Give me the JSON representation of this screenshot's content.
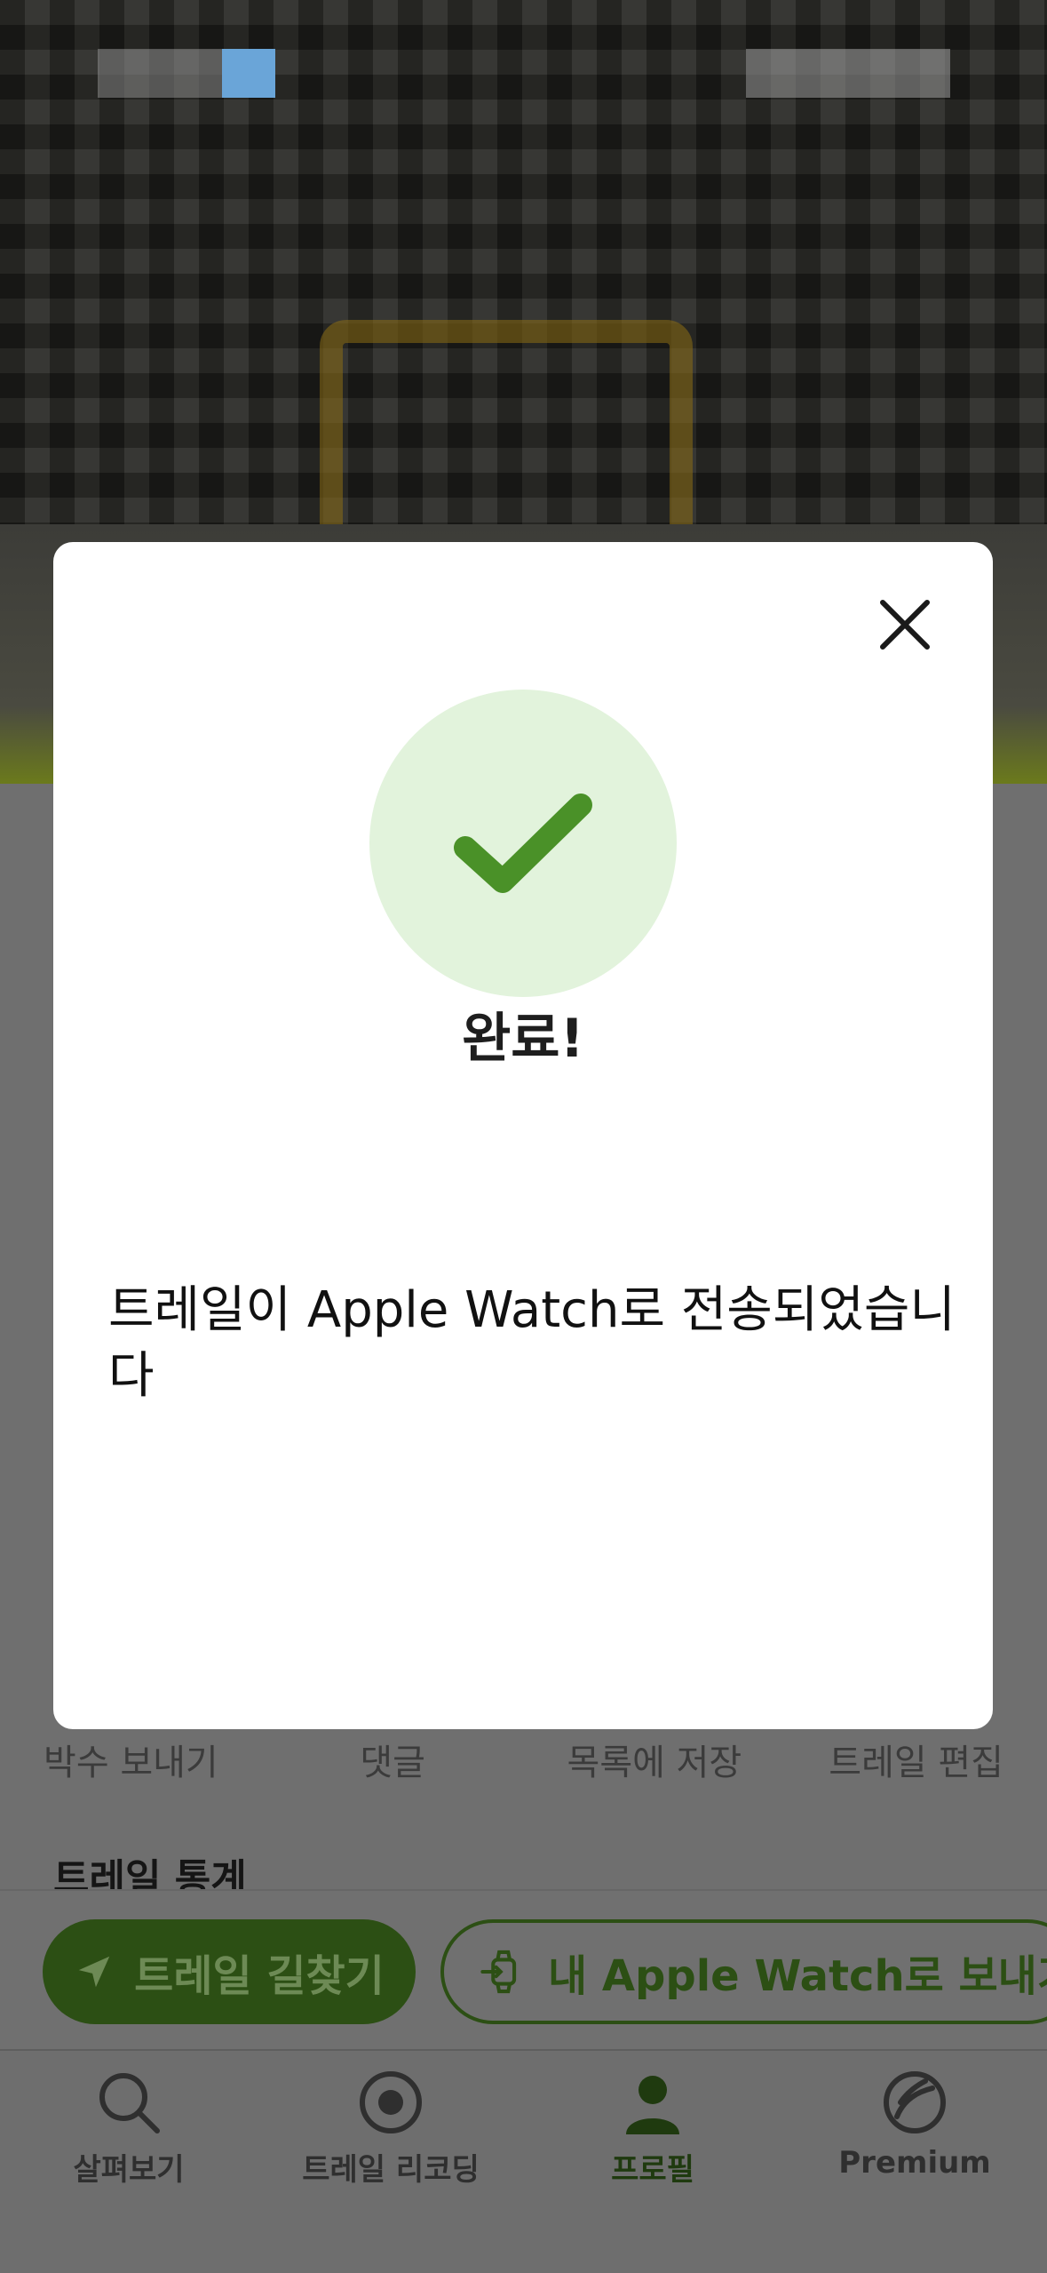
{
  "modal": {
    "title": "완료!",
    "message": "트레일이 Apple Watch로 전송되었습니다"
  },
  "actions": [
    "박수 보내기",
    "댓글",
    "목록에 저장",
    "트레일 편집"
  ],
  "section": {
    "stats_title": "트레일 통계"
  },
  "buttons": {
    "navigate": "트레일 길찾기",
    "send_watch": "내 Apple Watch로 보내기"
  },
  "tabs": [
    {
      "label": "살펴보기",
      "icon": "search-icon"
    },
    {
      "label": "트레일 리코딩",
      "icon": "record-icon"
    },
    {
      "label": "프로필",
      "icon": "profile-icon"
    },
    {
      "label": "Premium",
      "icon": "premium-icon"
    }
  ],
  "colors": {
    "accent_green": "#4a9128",
    "check_bg": "#e2f3dc",
    "dark_green": "#2c4f14"
  }
}
